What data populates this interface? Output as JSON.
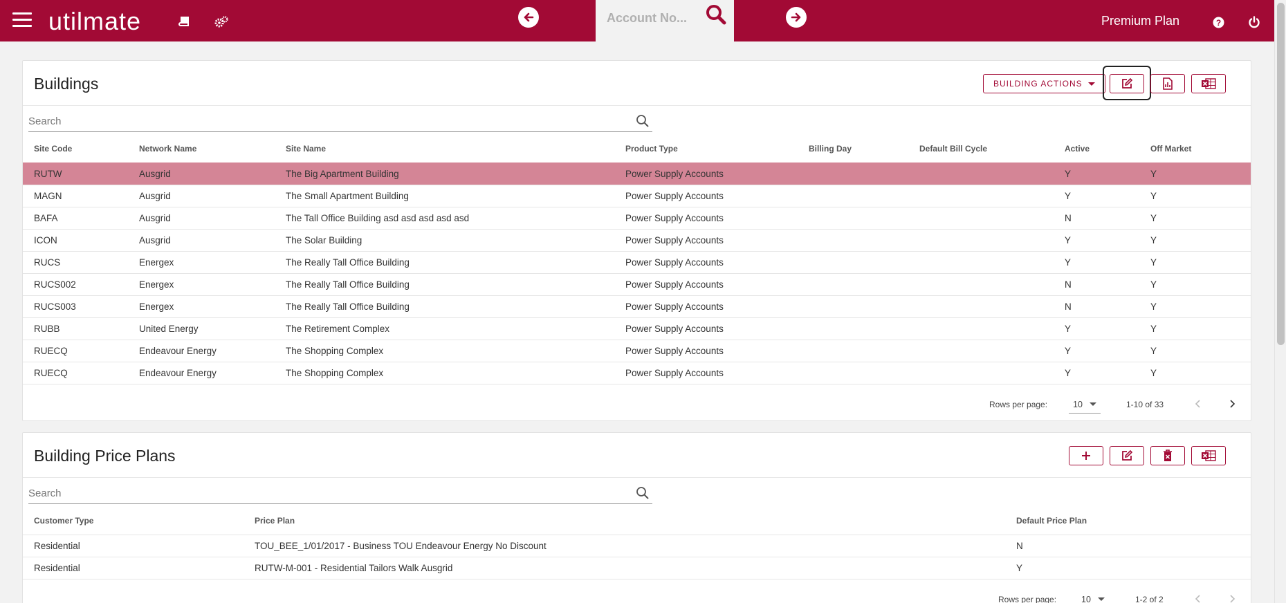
{
  "header": {
    "logo": "utilmate",
    "account_placeholder": "Account No...",
    "plan": "Premium Plan",
    "colors": {
      "brand": "#a20a35",
      "selected_row": "#d48596"
    },
    "icons": [
      "menu-icon",
      "book-icon",
      "gears-icon",
      "arrow-left-icon",
      "search-icon",
      "arrow-right-icon",
      "help-icon",
      "power-icon"
    ]
  },
  "buildings": {
    "title": "Buildings",
    "actions_label": "BUILDING ACTIONS",
    "search_placeholder": "Search",
    "columns": [
      "Site Code",
      "Network Name",
      "Site Name",
      "Product Type",
      "Billing Day",
      "Default Bill Cycle",
      "Active",
      "Off Market"
    ],
    "rows": [
      [
        "RUTW",
        "Ausgrid",
        "The Big Apartment Building",
        "Power Supply Accounts",
        "",
        "",
        "Y",
        "Y"
      ],
      [
        "MAGN",
        "Ausgrid",
        "The Small Apartment Building",
        "Power Supply Accounts",
        "",
        "",
        "Y",
        "Y"
      ],
      [
        "BAFA",
        "Ausgrid",
        "The Tall Office Building asd asd asd asd asd",
        "Power Supply Accounts",
        "",
        "",
        "N",
        "Y"
      ],
      [
        "ICON",
        "Ausgrid",
        "The Solar Building",
        "Power Supply Accounts",
        "",
        "",
        "Y",
        "Y"
      ],
      [
        "RUCS",
        "Energex",
        "The Really Tall Office Building",
        "Power Supply Accounts",
        "",
        "",
        "Y",
        "Y"
      ],
      [
        "RUCS002",
        "Energex",
        "The Really Tall Office Building",
        "Power Supply Accounts",
        "",
        "",
        "N",
        "Y"
      ],
      [
        "RUCS003",
        "Energex",
        "The Really Tall Office Building",
        "Power Supply Accounts",
        "",
        "",
        "N",
        "Y"
      ],
      [
        "RUBB",
        "United Energy",
        "The Retirement Complex",
        "Power Supply Accounts",
        "",
        "",
        "Y",
        "Y"
      ],
      [
        "RUECQ",
        "Endeavour Energy",
        "The Shopping Complex",
        "Power Supply Accounts",
        "",
        "",
        "Y",
        "Y"
      ],
      [
        "RUECQ",
        "Endeavour Energy",
        "The Shopping Complex",
        "Power Supply Accounts",
        "",
        "",
        "Y",
        "Y"
      ]
    ],
    "pager": {
      "rows_label": "Rows per page:",
      "rows_value": "10",
      "range": "1-10 of 33"
    }
  },
  "price_plans": {
    "title": "Building Price Plans",
    "search_placeholder": "Search",
    "columns": [
      "Customer Type",
      "Price Plan",
      "Default Price Plan"
    ],
    "rows": [
      [
        "Residential",
        "TOU_BEE_1/01/2017 - Business TOU Endeavour Energy No Discount",
        "N"
      ],
      [
        "Residential",
        "RUTW-M-001 - Residential Tailors Walk Ausgrid",
        "Y"
      ]
    ],
    "pager": {
      "rows_label": "Rows per page:",
      "rows_value": "10",
      "range": "1-2 of 2"
    }
  }
}
